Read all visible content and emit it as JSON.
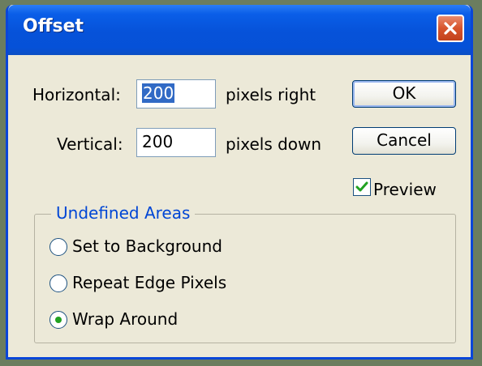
{
  "dialog": {
    "title": "Offset"
  },
  "horizontal": {
    "label": "Horizontal:",
    "value": "200",
    "unit": "pixels right"
  },
  "vertical": {
    "label": "Vertical:",
    "value": "200",
    "unit": "pixels down"
  },
  "buttons": {
    "ok": "OK",
    "cancel": "Cancel"
  },
  "preview": {
    "label": "Preview",
    "checked": true
  },
  "undefined_areas": {
    "legend": "Undefined Areas",
    "options": [
      {
        "label": "Set to Background",
        "selected": false
      },
      {
        "label": "Repeat Edge Pixels",
        "selected": false
      },
      {
        "label": "Wrap Around",
        "selected": true
      }
    ]
  },
  "colors": {
    "titlebar": "#0652d9",
    "dialog_bg": "#ece9d8",
    "legend_text": "#0046d5",
    "selection": "#316ac5",
    "radio_dot": "#21a121",
    "checkmark": "#21a121",
    "close_button": "#d7542c"
  },
  "icons": {
    "close": "close-icon",
    "check": "checkmark-icon"
  }
}
